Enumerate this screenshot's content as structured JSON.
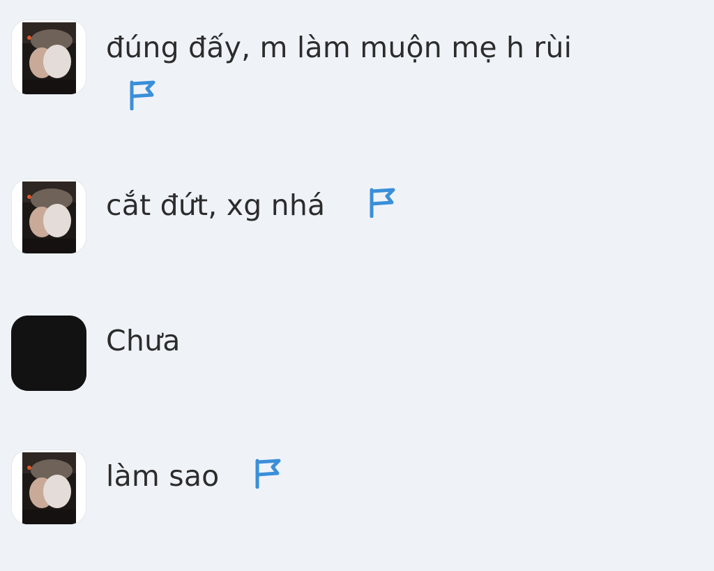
{
  "messages": [
    {
      "text": "đúng đấy, m làm muộn mẹ h rùi",
      "avatar": "profile-photo",
      "has_flag": true
    },
    {
      "text": "cắt đứt, xg nhá",
      "avatar": "profile-photo",
      "has_flag": true
    },
    {
      "text": "Chưa",
      "avatar": "dark-square",
      "has_flag": false
    },
    {
      "text": "làm sao",
      "avatar": "profile-photo",
      "has_flag": true
    }
  ],
  "icons": {
    "flag": "flag-icon"
  },
  "colors": {
    "background": "#eff3f8",
    "text": "#2c2c2c",
    "flag_accent": "#3b8fd9",
    "dark_avatar": "#121212"
  }
}
